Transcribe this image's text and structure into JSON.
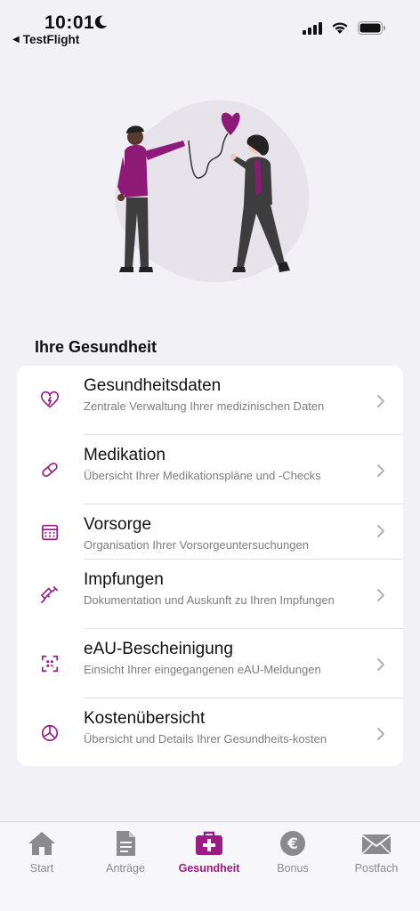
{
  "status": {
    "time": "10:01",
    "back_app": "TestFlight"
  },
  "section_title": "Ihre Gesundheit",
  "items": [
    {
      "title": "Gesundheitsdaten",
      "subtitle": "Zentrale Verwaltung Ihrer medizinischen Daten",
      "icon": "heart-pulse-icon"
    },
    {
      "title": "Medikation",
      "subtitle": "Übersicht Ihrer Medikationspläne und -Checks",
      "icon": "pill-icon"
    },
    {
      "title": "Vorsorge",
      "subtitle": "Organisation Ihrer Vorsorgeuntersuchungen",
      "icon": "calendar-icon"
    },
    {
      "title": "Impfungen",
      "subtitle": "Dokumentation und Auskunft zu Ihren Impfungen",
      "icon": "syringe-icon"
    },
    {
      "title": "eAU-Bescheinigung",
      "subtitle": "Einsicht Ihrer eingegangenen eAU-Meldungen",
      "icon": "qr-scan-icon"
    },
    {
      "title": "Kostenübersicht",
      "subtitle": "Übersicht und Details Ihrer Gesundheits-kosten",
      "icon": "pie-chart-icon"
    }
  ],
  "tabs": [
    {
      "label": "Start",
      "icon": "home-icon",
      "active": false
    },
    {
      "label": "Anträge",
      "icon": "document-icon",
      "active": false
    },
    {
      "label": "Gesundheit",
      "icon": "medical-bag-icon",
      "active": true
    },
    {
      "label": "Bonus",
      "icon": "euro-coin-icon",
      "active": false
    },
    {
      "label": "Postfach",
      "icon": "mail-icon",
      "active": false
    }
  ],
  "colors": {
    "accent": "#9b1d84",
    "background": "#f2f1f6",
    "inactive_tab": "#8a8a8f"
  }
}
